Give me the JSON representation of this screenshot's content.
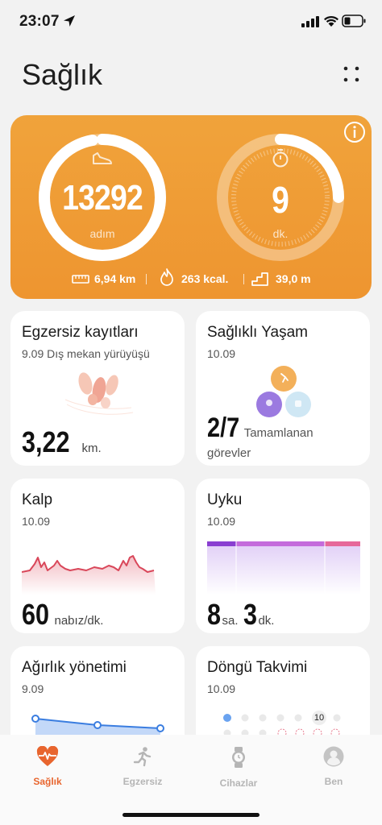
{
  "status_bar": {
    "time": "23:07"
  },
  "page": {
    "title": "Sağlık"
  },
  "hero": {
    "steps_value": "13292",
    "steps_unit": "adım",
    "minutes_value": "9",
    "minutes_unit": "dk.",
    "distance": "6,94 km",
    "calories": "263 kcal.",
    "floors": "39,0 m"
  },
  "cards": {
    "exercise": {
      "title": "Egzersiz kayıtları",
      "subtitle": "9.09 Dış mekan yürüyüşü",
      "value": "3,22",
      "unit": "km."
    },
    "healthy": {
      "title": "Sağlıklı Yaşam",
      "subtitle": "10.09",
      "value": "2/7",
      "label_1": "Tamamlanan",
      "label_2": "görevler"
    },
    "heart": {
      "title": "Kalp",
      "subtitle": "10.09",
      "value": "60",
      "unit": "nabız/dk."
    },
    "sleep": {
      "title": "Uyku",
      "subtitle": "10.09",
      "hours": "8",
      "hours_unit": "sa.",
      "minutes": "3",
      "minutes_unit": "dk."
    },
    "weight": {
      "title": "Ağırlık yönetimi",
      "subtitle": "9.09"
    },
    "cycle": {
      "title": "Döngü Takvimi",
      "subtitle": "10.09",
      "day": "10"
    }
  },
  "tabs": [
    {
      "label": "Sağlık",
      "active": true
    },
    {
      "label": "Egzersiz",
      "active": false
    },
    {
      "label": "Cihazlar",
      "active": false
    },
    {
      "label": "Ben",
      "active": false
    }
  ],
  "colors": {
    "accent": "#e8652e",
    "hero": "#ef9a34",
    "heart_line": "#d9475a",
    "sleep_deep": "#8a3fd1",
    "sleep_light": "#c46bdc",
    "sleep_rem": "#e6689a"
  }
}
